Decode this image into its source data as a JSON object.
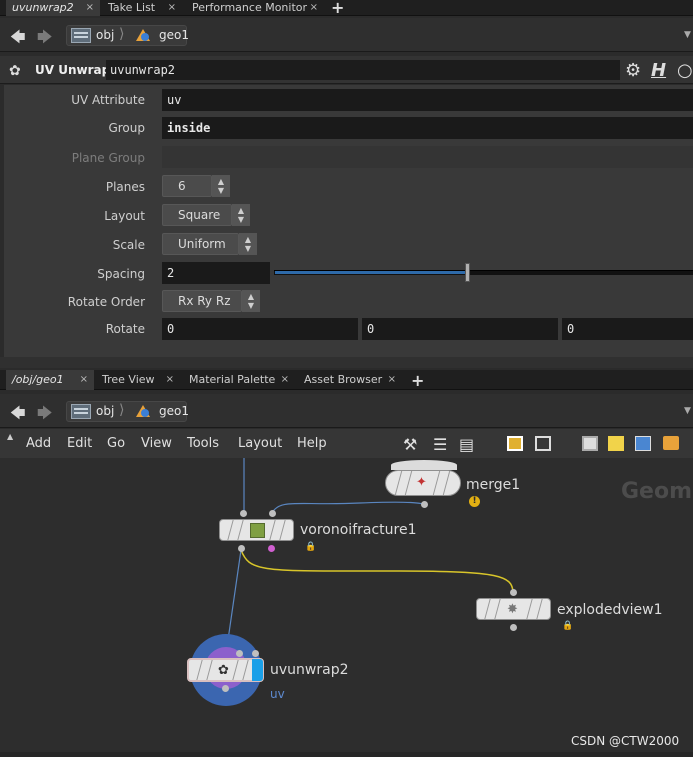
{
  "top_tabs": [
    {
      "label": "uvunwrap2",
      "close": "×"
    },
    {
      "label": "Take List",
      "close": "×"
    },
    {
      "label": "Performance Monitor",
      "close": "×"
    }
  ],
  "top_path": {
    "obj": "obj",
    "geo": "geo1"
  },
  "param_header": {
    "type_label": "UV Unwrap",
    "node_name": "uvunwrap2"
  },
  "params": {
    "uv_attribute": {
      "label": "UV Attribute",
      "value": "uv"
    },
    "group": {
      "label": "Group",
      "value": "inside"
    },
    "plane_group": {
      "label": "Plane Group",
      "value": ""
    },
    "planes": {
      "label": "Planes",
      "value": "6"
    },
    "layout": {
      "label": "Layout",
      "value": "Square"
    },
    "scale": {
      "label": "Scale",
      "value": "Uniform"
    },
    "spacing": {
      "label": "Spacing",
      "value": "2",
      "slider_fraction": 0.46
    },
    "rotate_order": {
      "label": "Rotate Order",
      "value": "Rx Ry Rz"
    },
    "rotate": {
      "label": "Rotate",
      "x": "0",
      "y": "0",
      "z": "0"
    }
  },
  "bottom_tabs": [
    {
      "label": "/obj/geo1",
      "close": "×"
    },
    {
      "label": "Tree View",
      "close": "×"
    },
    {
      "label": "Material Palette",
      "close": "×"
    },
    {
      "label": "Asset Browser",
      "close": "×"
    }
  ],
  "bottom_path": {
    "obj": "obj",
    "geo": "geo1"
  },
  "net_menu": [
    "Add",
    "Edit",
    "Go",
    "View",
    "Tools",
    "Layout",
    "Help"
  ],
  "network": {
    "watermark": "Geom",
    "nodes": {
      "merge": {
        "name": "merge1"
      },
      "voronoi": {
        "name": "voronoifracture1"
      },
      "exploded": {
        "name": "explodedview1"
      },
      "uvunwrap": {
        "name": "uvunwrap2",
        "sublabel": "uv"
      }
    },
    "credit": "CSDN @CTW2000"
  },
  "colors": {
    "accent": "#2e6aa9",
    "selected_ring": "#3b66b0",
    "wire_yellow": "#d8c52a",
    "wire_blue": "#5a86c0",
    "warning": "#e3b013"
  }
}
